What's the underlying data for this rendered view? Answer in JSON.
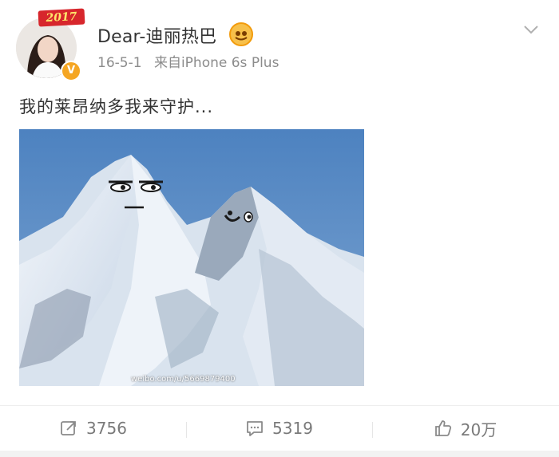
{
  "post": {
    "badge_year": "2017",
    "username": "Dear-迪丽热巴",
    "date": "16-5-1",
    "source": "来自iPhone 6s Plus",
    "text": "我的莱昂纳多我来守护...",
    "watermark": "weibo.com/u/5669879400"
  },
  "actions": {
    "repost_count": "3756",
    "comment_count": "5319",
    "like_count": "20万"
  },
  "colors": {
    "verified": "#f5a623",
    "badge": "#d7262c",
    "text": "#333333",
    "meta": "#8c8c8c"
  },
  "icons": {
    "verified": "verified-v-icon",
    "member": "member-crown-icon",
    "dropdown": "chevron-down-icon",
    "repost": "repost-icon",
    "comment": "comment-icon",
    "like": "thumbs-up-icon"
  }
}
